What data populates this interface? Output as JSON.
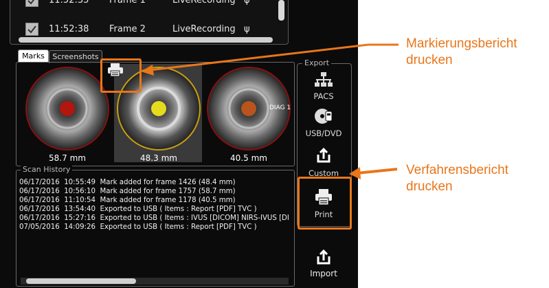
{
  "frames_table": {
    "rows": [
      {
        "time": "11:52:35",
        "frame": "Frame 1",
        "source": "LiveRecording",
        "icon": "usb-icon"
      },
      {
        "time": "11:52:38",
        "frame": "Frame 2",
        "source": "LiveRecording",
        "icon": "usb-icon"
      }
    ]
  },
  "tabs": [
    {
      "label": "Marks",
      "active": true
    },
    {
      "label": "Screenshots",
      "active": false
    }
  ],
  "marks": [
    {
      "measurement": "58.7 mm",
      "marker_color": "#b3150f",
      "selected": false
    },
    {
      "measurement": "48.3 mm",
      "marker_color": "#e6dc1c",
      "selected": true
    },
    {
      "measurement": "40.5 mm",
      "marker_color": "#b8541c",
      "selected": false,
      "overlay_text": "DIAG 1"
    }
  ],
  "scan_history": {
    "title": "Scan History",
    "entries": [
      {
        "date": "06/17/2016",
        "time": "10:55:49",
        "text": "Mark added for frame 1426 (48.4 mm)"
      },
      {
        "date": "06/17/2016",
        "time": "10:56:10",
        "text": "Mark added for frame 1757 (58.7 mm)"
      },
      {
        "date": "06/17/2016",
        "time": "11:10:54",
        "text": "Mark added for frame 1178 (40.5 mm)"
      },
      {
        "date": "06/17/2016",
        "time": "13:54:40",
        "text": "Exported to USB ( Items : Report [PDF] TVC )"
      },
      {
        "date": "06/17/2016",
        "time": "15:27:16",
        "text": "Exported to USB ( Items : IVUS [DICOM] NIRS-IVUS [DI"
      },
      {
        "date": "07/05/2016",
        "time": "14:09:26",
        "text": "Exported to USB ( Items : Report [PDF] TVC )"
      }
    ]
  },
  "export": {
    "title": "Export",
    "buttons": [
      {
        "label": "PACS",
        "icon": "network-icon"
      },
      {
        "label": "USB/DVD",
        "icon": "disc-usb-icon"
      },
      {
        "label": "Custom",
        "icon": "export-arrow-icon"
      },
      {
        "label": "Print",
        "icon": "printer-icon"
      }
    ]
  },
  "import_button": {
    "label": "Import",
    "icon": "import-arrow-icon"
  },
  "annotations": {
    "marks_report_line1": "Markierungsbericht",
    "marks_report_line2": "drucken",
    "procedure_report_line1": "Verfahrensbericht",
    "procedure_report_line2": "drucken"
  },
  "colors": {
    "accent": "#e9761a",
    "background": "#0b0b0b"
  }
}
